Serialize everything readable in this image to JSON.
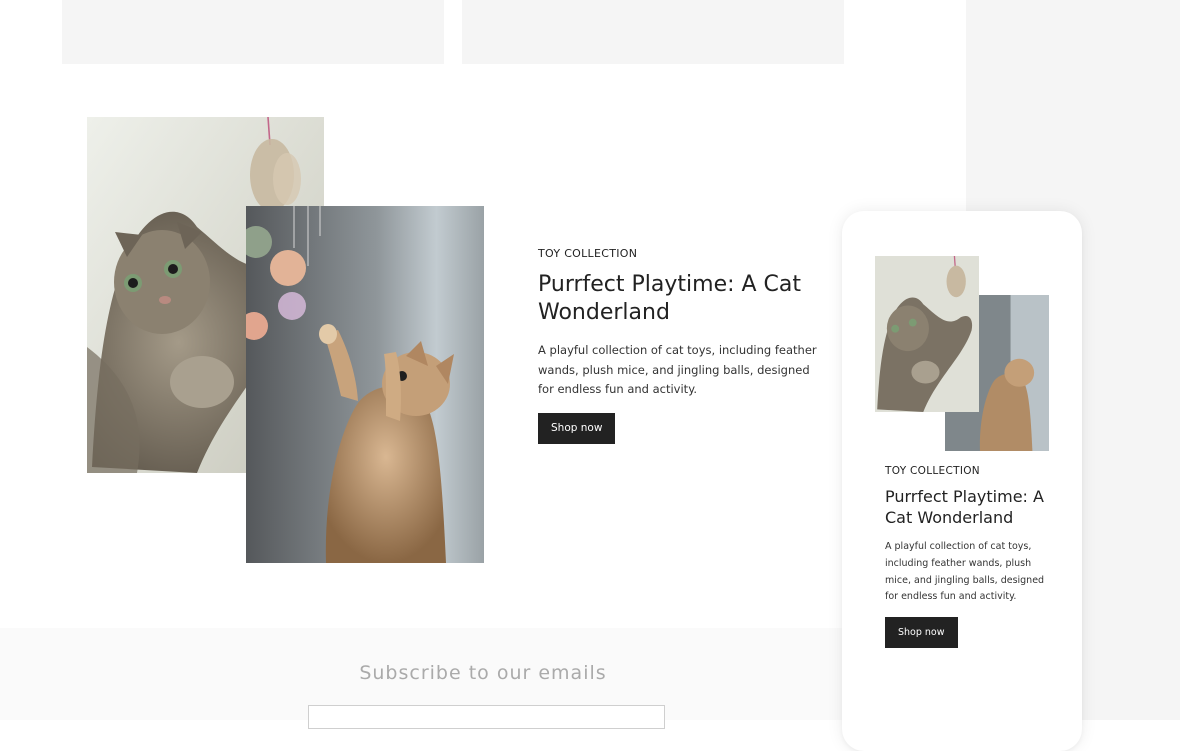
{
  "feature": {
    "eyebrow": "TOY COLLECTION",
    "title": "Purrfect Playtime: A Cat Wonderland",
    "description": "A playful collection of cat toys, including feather wands, plush mice, and jingling balls, designed for endless fun and activity.",
    "button_label": "Shop now"
  },
  "mobile_preview": {
    "eyebrow": "TOY COLLECTION",
    "title": "Purrfect Playtime: A Cat Wonderland",
    "description": "A playful collection of cat toys, including feather wands, plush mice, and jingling balls, designed for endless fun and activity.",
    "button_label": "Shop now"
  },
  "newsletter": {
    "heading": "Subscribe to our emails"
  },
  "colors": {
    "button_bg": "#222222",
    "panel_bg": "#f5f5f5"
  }
}
